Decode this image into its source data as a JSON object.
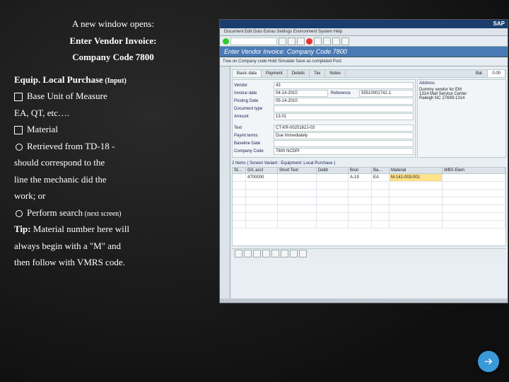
{
  "left": {
    "l1": "A new window opens:",
    "l2": "Enter Vendor Invoice:",
    "l3": "Company Code 7800",
    "heading": "Equip. Local Purchase",
    "heading_sub": " (Input)",
    "b1": "Base Unit of Measure",
    "b1_sub": "EA, QT, etc….",
    "b2": "Material",
    "b2_o1": "Retrieved from TD-18 - should correspond to the line the mechanic did the work; or",
    "b2_o2": "Perform search",
    "b2_o2_sub": " (next screen)",
    "tip_label": "Tip:",
    "tip_text": "Material number here will always begin with a \"M\" and then follow with VMRS code."
  },
  "sap": {
    "logo": "SAP",
    "menu": "Document  Edit  Goto  Extras  Settings  Environment  System  Help",
    "header": "Enter Vendor Invoice: Company Code 7800",
    "toolbar2_items": "Tree on   Company code   Hold   Simulate   Save as completed   Post",
    "tabs_row1": {
      "basic": "Basic data",
      "payment": "Payment",
      "details": "Details",
      "tax": "Tax",
      "notes": "Notes",
      "bal": "Bal.",
      "balval": "0.00"
    },
    "vendor_panel": {
      "addr": "Address",
      "vendor_lbl": "Vendor",
      "vendor": "43",
      "inv_lbl": "Invoice date",
      "inv": "04-14-2010",
      "post_lbl": "Posting Date",
      "post": "05-14-2010",
      "ref_lbl": "Reference",
      "ref": "55510001741-1",
      "doc_lbl": "Document type",
      "doc": "",
      "amt_lbl": "Amount",
      "amt": "13.01",
      "txt_lbl": "Text",
      "txt": "CT-KR-0025162J-03",
      "pay_lbl": "Paymt terms",
      "pay": "Due Immediately",
      "base_lbl": "Baseline Date",
      "base": "",
      "cc_lbl": "Company Code",
      "cc": "7800 NCDPI",
      "dummy": "Dummy vendor for EM",
      "svc": "1314 Mail Service Center",
      "reg": "Raleigh NC  27699-1314"
    },
    "grid_title": "2 Items ( Screen Variant : Equipment: Local Purchase )",
    "cols": {
      "st": "St…",
      "acct": "G/L acct",
      "short": "Short Text",
      "debit": "Debit",
      "bun": "B/un",
      "ba": "Ba…",
      "material": "Material",
      "wbs": "WBS Elem"
    },
    "row1": {
      "acct": "4700000",
      "short": "",
      "debit": "",
      "bun": "A-19",
      "ba": "EA",
      "material": "M-141-003-001",
      "wbs": ""
    }
  }
}
